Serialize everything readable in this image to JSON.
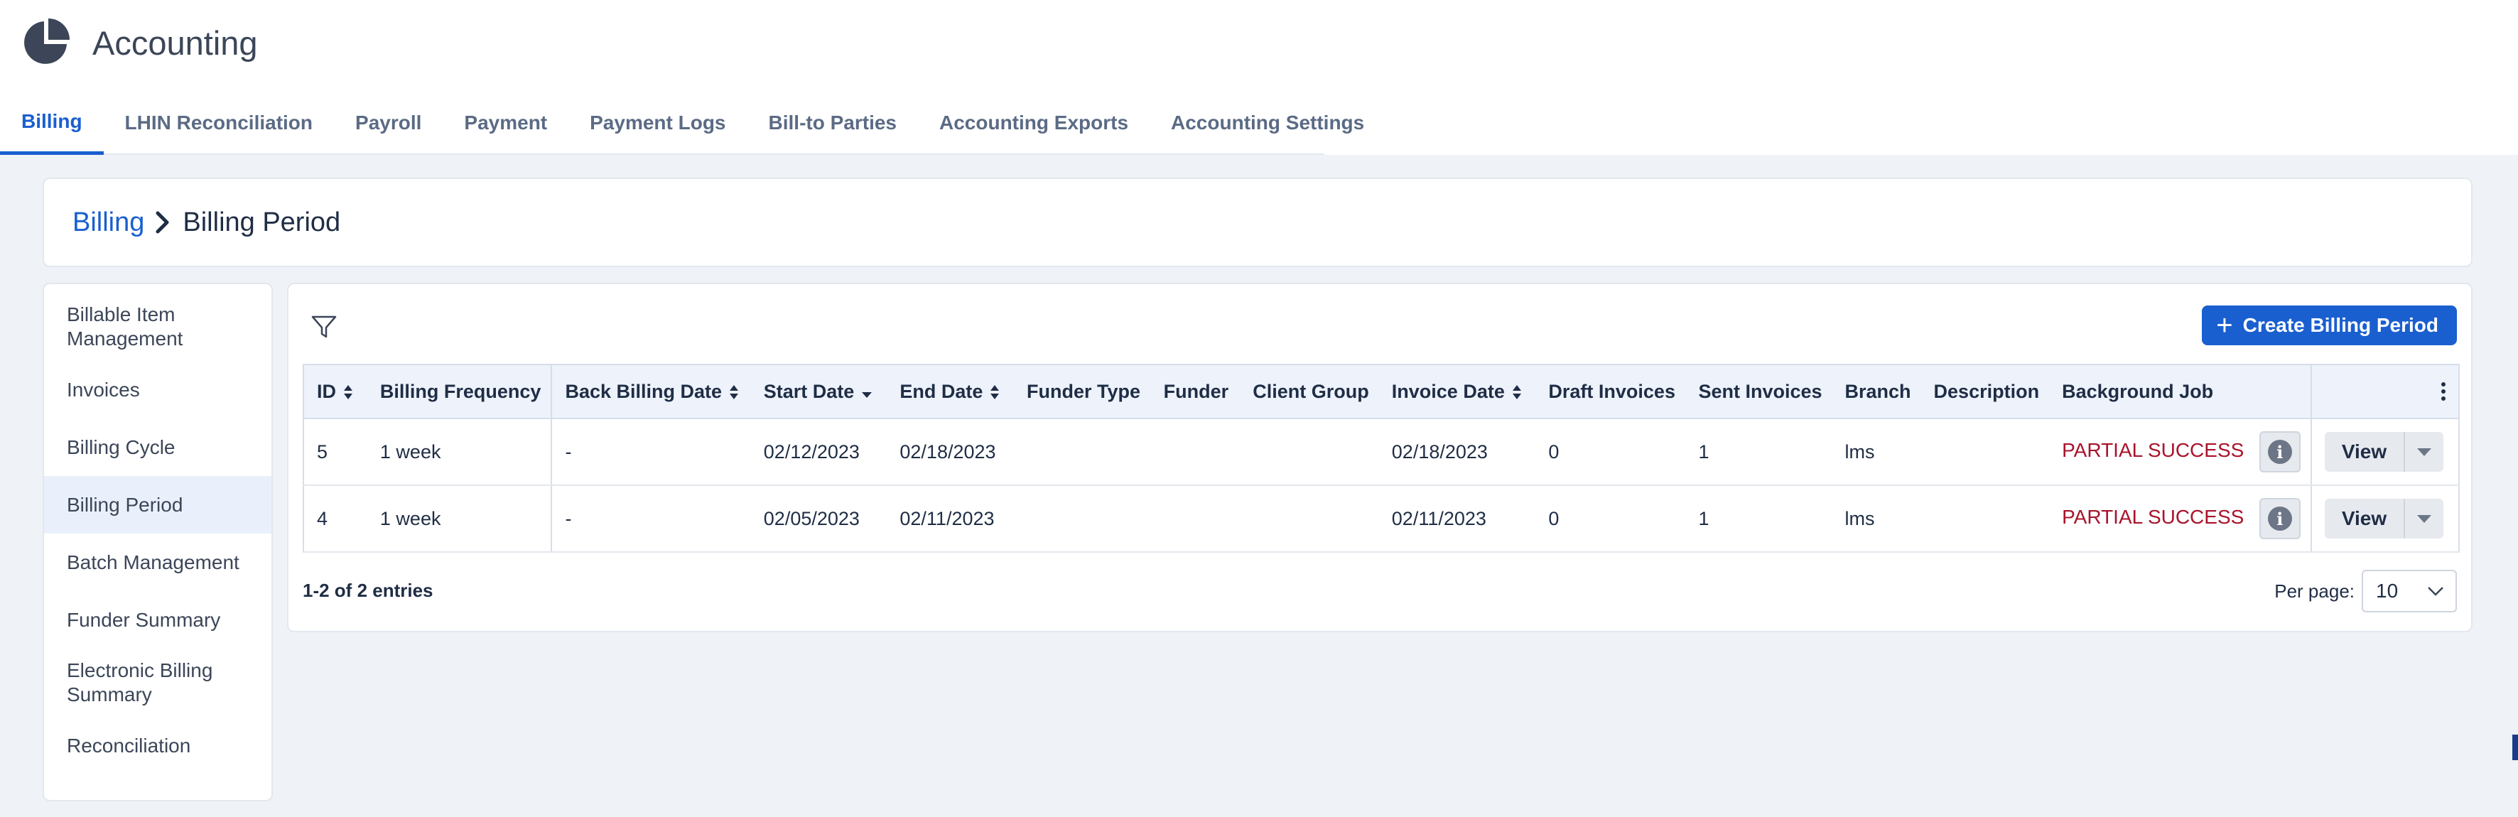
{
  "app": {
    "title": "Accounting",
    "icon": "pie-chart-icon"
  },
  "tabs": [
    {
      "label": "Billing",
      "active": true
    },
    {
      "label": "LHIN Reconciliation",
      "active": false
    },
    {
      "label": "Payroll",
      "active": false
    },
    {
      "label": "Payment",
      "active": false
    },
    {
      "label": "Payment Logs",
      "active": false
    },
    {
      "label": "Bill-to Parties",
      "active": false
    },
    {
      "label": "Accounting Exports",
      "active": false
    },
    {
      "label": "Accounting Settings",
      "active": false
    }
  ],
  "breadcrumb": {
    "parent": "Billing",
    "current": "Billing Period"
  },
  "sidenav": [
    {
      "label": "Billable Item Management",
      "active": false
    },
    {
      "label": "Invoices",
      "active": false
    },
    {
      "label": "Billing Cycle",
      "active": false
    },
    {
      "label": "Billing Period",
      "active": true
    },
    {
      "label": "Batch Management",
      "active": false
    },
    {
      "label": "Funder Summary",
      "active": false
    },
    {
      "label": "Electronic Billing Summary",
      "active": false
    },
    {
      "label": "Reconciliation",
      "active": false
    }
  ],
  "toolbar": {
    "create_label": "Create Billing Period"
  },
  "table": {
    "headers": {
      "id": "ID",
      "billing_frequency": "Billing Frequency",
      "back_billing_date": "Back Billing Date",
      "start_date": "Start Date",
      "end_date": "End Date",
      "funder_type": "Funder Type",
      "funder": "Funder",
      "client_group": "Client Group",
      "invoice_date": "Invoice Date",
      "draft_invoices": "Draft Invoices",
      "sent_invoices": "Sent Invoices",
      "branch": "Branch",
      "description": "Description",
      "background_job": "Background Job"
    },
    "rows": [
      {
        "id": "5",
        "billing_frequency": "1 week",
        "back_billing_date": "-",
        "start_date": "02/12/2023",
        "end_date": "02/18/2023",
        "funder_type": "",
        "funder": "",
        "client_group": "",
        "invoice_date": "02/18/2023",
        "draft_invoices": "0",
        "sent_invoices": "1",
        "branch": "lms",
        "description": "",
        "background_job": "PARTIAL SUCCESS",
        "action": "View"
      },
      {
        "id": "4",
        "billing_frequency": "1 week",
        "back_billing_date": "-",
        "start_date": "02/05/2023",
        "end_date": "02/11/2023",
        "funder_type": "",
        "funder": "",
        "client_group": "",
        "invoice_date": "02/11/2023",
        "draft_invoices": "0",
        "sent_invoices": "1",
        "branch": "lms",
        "description": "",
        "background_job": "PARTIAL SUCCESS",
        "action": "View"
      }
    ]
  },
  "footer": {
    "entries": "1-2 of 2 entries",
    "per_page_label": "Per page:",
    "per_page_value": "10"
  },
  "colors": {
    "accent": "#1a5fd0",
    "status_error": "#a8142b",
    "background": "#eff2f6"
  }
}
